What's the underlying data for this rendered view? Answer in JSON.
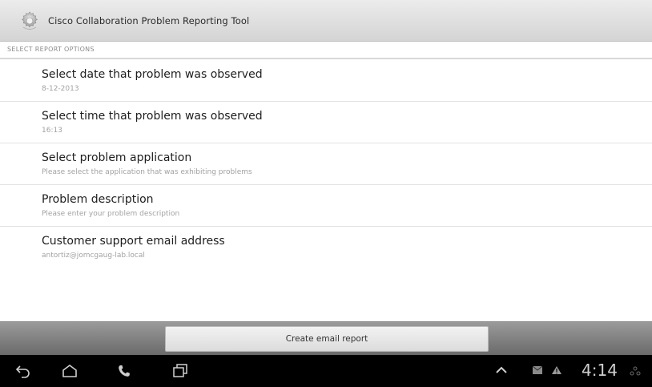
{
  "title_bar": {
    "app_title": "Cisco Collaboration Problem Reporting Tool",
    "icon": "gear-icon"
  },
  "section": {
    "header": "SELECT REPORT OPTIONS"
  },
  "options": [
    {
      "title": "Select date that problem was observed",
      "summary": "8-12-2013"
    },
    {
      "title": "Select time that problem was observed",
      "summary": "16:13"
    },
    {
      "title": "Select problem application",
      "summary": "Please select the application that was exhibiting problems"
    },
    {
      "title": "Problem description",
      "summary": "Please enter your problem description"
    },
    {
      "title": "Customer support email address",
      "summary": "antortiz@jomcgaug-lab.local"
    }
  ],
  "action_bar": {
    "button_label": "Create email report"
  },
  "system_bar": {
    "nav_icons": [
      "back-icon",
      "home-icon",
      "phone-icon",
      "recent-apps-icon"
    ],
    "status_icons": [
      "chevron-up-icon",
      "email-icon",
      "warning-icon",
      "network-icon"
    ],
    "clock": "4:14"
  },
  "colors": {
    "title_bar_bg": "#dcdcdc",
    "action_bar_bg": "#7a7a7a",
    "nav_bar_bg": "#000000",
    "primary_text": "#1e1e1e",
    "secondary_text": "#a2a2a2"
  }
}
